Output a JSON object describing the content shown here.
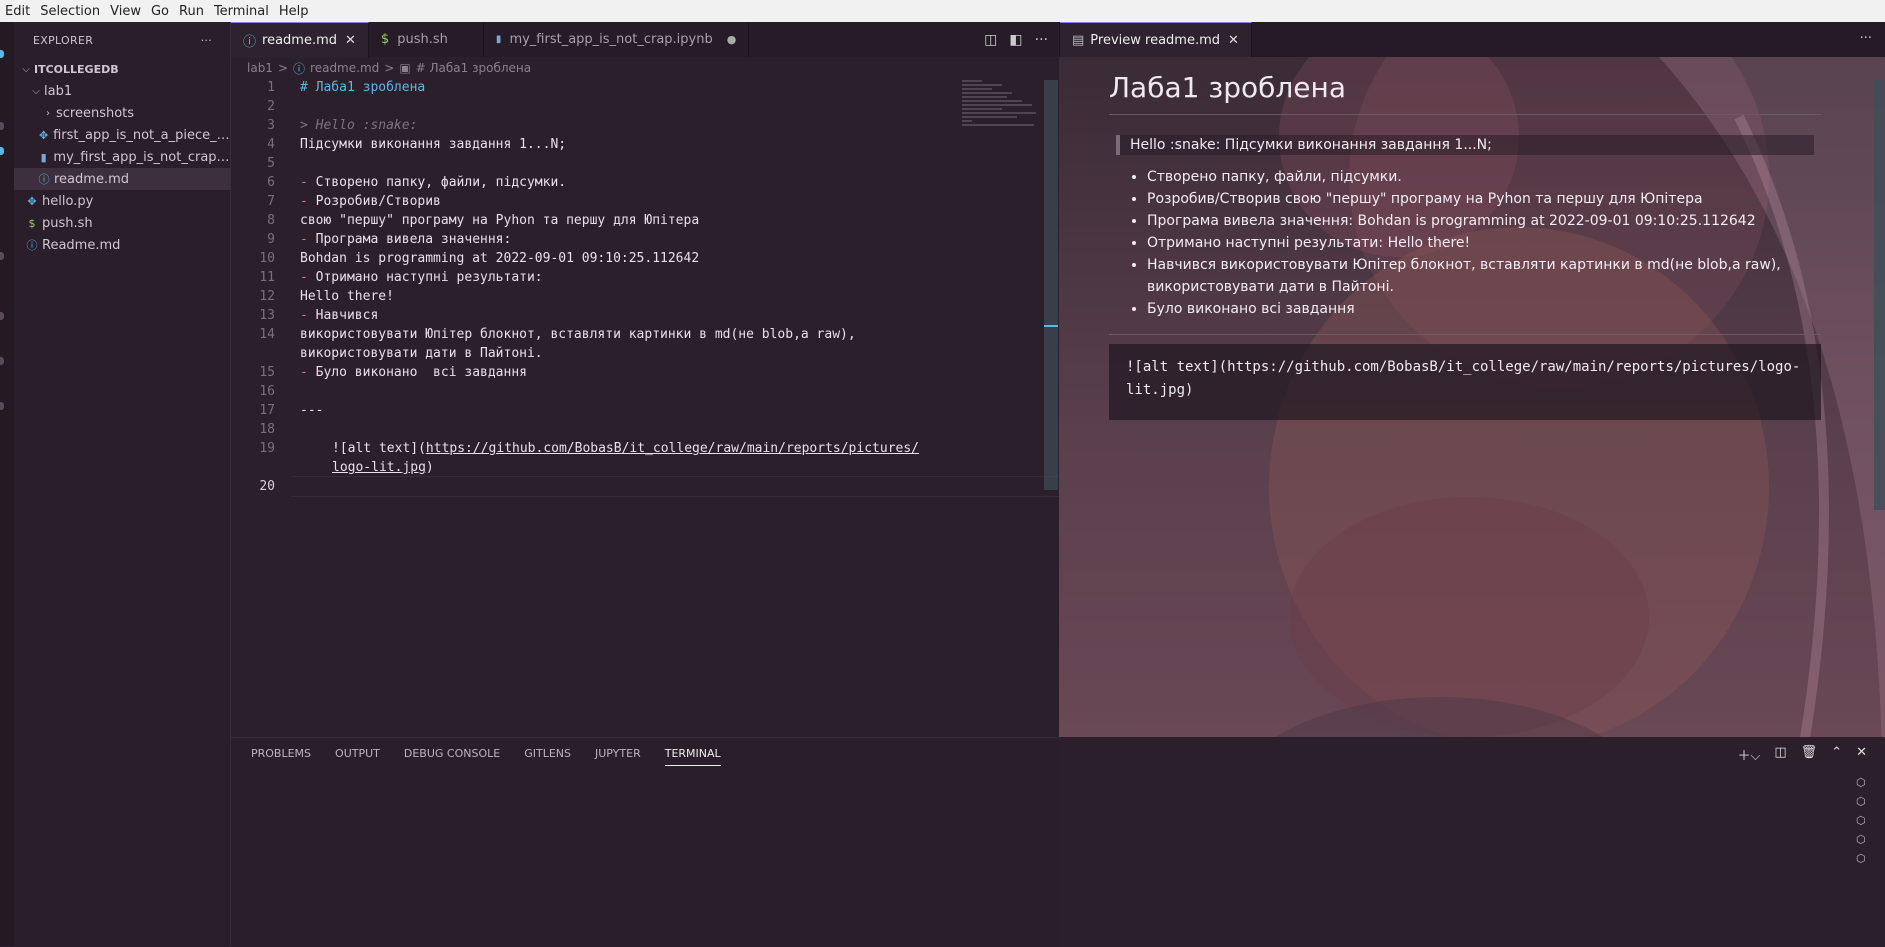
{
  "menubar": {
    "items": [
      "Edit",
      "Selection",
      "View",
      "Go",
      "Run",
      "Terminal",
      "Help"
    ]
  },
  "explorer": {
    "header": "EXPLORER",
    "more": "···",
    "root": "ITCOLLEGEDB",
    "items": [
      {
        "label": "lab1"
      },
      {
        "label": "screenshots"
      },
      {
        "label": "first_app_is_not_a_piece_of..."
      },
      {
        "label": "my_first_app_is_not_crap.i..."
      },
      {
        "label": "readme.md"
      },
      {
        "label": "hello.py"
      },
      {
        "label": "push.sh"
      },
      {
        "label": "Readme.md"
      }
    ]
  },
  "editor": {
    "tabs": [
      {
        "label": "readme.md",
        "icon": "ⓘ",
        "close": "✕"
      },
      {
        "label": "push.sh",
        "icon": "$"
      },
      {
        "label": "my_first_app_is_not_crap.ipynb",
        "icon": "▮",
        "dirty": "●"
      }
    ],
    "breadcrumb": {
      "folder": "lab1",
      "sep": ">",
      "file": "readme.md",
      "symbol": "# Лаба1 зроблена"
    },
    "lines": [
      {
        "n": "1",
        "text": "# Лаба1 зроблена"
      },
      {
        "n": "2",
        "text": ""
      },
      {
        "n": "3",
        "text": "> Hello :snake:"
      },
      {
        "n": "4",
        "text": "Підсумки виконання завдання 1...N;"
      },
      {
        "n": "5",
        "text": ""
      },
      {
        "n": "6",
        "bullet": "- ",
        "text": "Створено папку, файли, підсумки."
      },
      {
        "n": "7",
        "bullet": "- ",
        "text": "Розробив/Створив"
      },
      {
        "n": "8",
        "text": "свою \"першу\" програму на Pyhon та першу для Юпітера"
      },
      {
        "n": "9",
        "bullet": "- ",
        "text": "Програма вивела значення:"
      },
      {
        "n": "10",
        "text": "Bohdan is programming at 2022-09-01 09:10:25.112642"
      },
      {
        "n": "11",
        "bullet": "- ",
        "text": "Отримано наступні результати:"
      },
      {
        "n": "12",
        "text": "Hello there!"
      },
      {
        "n": "13",
        "bullet": "- ",
        "text": "Навчився"
      },
      {
        "n": "14",
        "text": "використовувати Юпітер блокнот, вставляти картинки в md(не blob,a raw),"
      },
      {
        "n": "",
        "text": "використовувати дати в Пайтоні."
      },
      {
        "n": "15",
        "bullet": "- ",
        "text": "Було виконано  всі завдання"
      },
      {
        "n": "16",
        "text": ""
      },
      {
        "n": "17",
        "text": "---"
      },
      {
        "n": "18",
        "text": ""
      },
      {
        "n": "19",
        "pre": "![alt text](",
        "link": "https://github.com/BobasB/it_college/raw/main/reports/pictures/"
      },
      {
        "n": "",
        "link": "logo-lit.jpg",
        "post": ")"
      },
      {
        "n": "20",
        "text": ""
      }
    ]
  },
  "preview": {
    "tab_label": "Preview readme.md",
    "tab_close": "✕",
    "more": "···",
    "title": "Лаба1 зроблена",
    "quote": "Hello :snake: Підсумки виконання завдання 1...N;",
    "bullets": [
      "Створено папку, файли, підсумки.",
      "Розробив/Створив свою \"першу\" програму на Pyhon та першу для Юпітера",
      "Програма вивела значення: Bohdan is programming at 2022-09-01 09:10:25.112642",
      "Отримано наступні результати: Hello there!",
      "Навчився використовувати Юпітер блокнот, вставляти картинки в md(не blob,a raw), використовувати дати в Пайтоні.",
      "Було виконано всі завдання"
    ],
    "code": "![alt text](https://github.com/BobasB/it_college/raw/main/reports/pictures/logo-lit.jpg)"
  },
  "panel": {
    "tabs": [
      "PROBLEMS",
      "OUTPUT",
      "DEBUG CONSOLE",
      "GITLENS",
      "JUPYTER",
      "TERMINAL"
    ],
    "active": "TERMINAL"
  }
}
